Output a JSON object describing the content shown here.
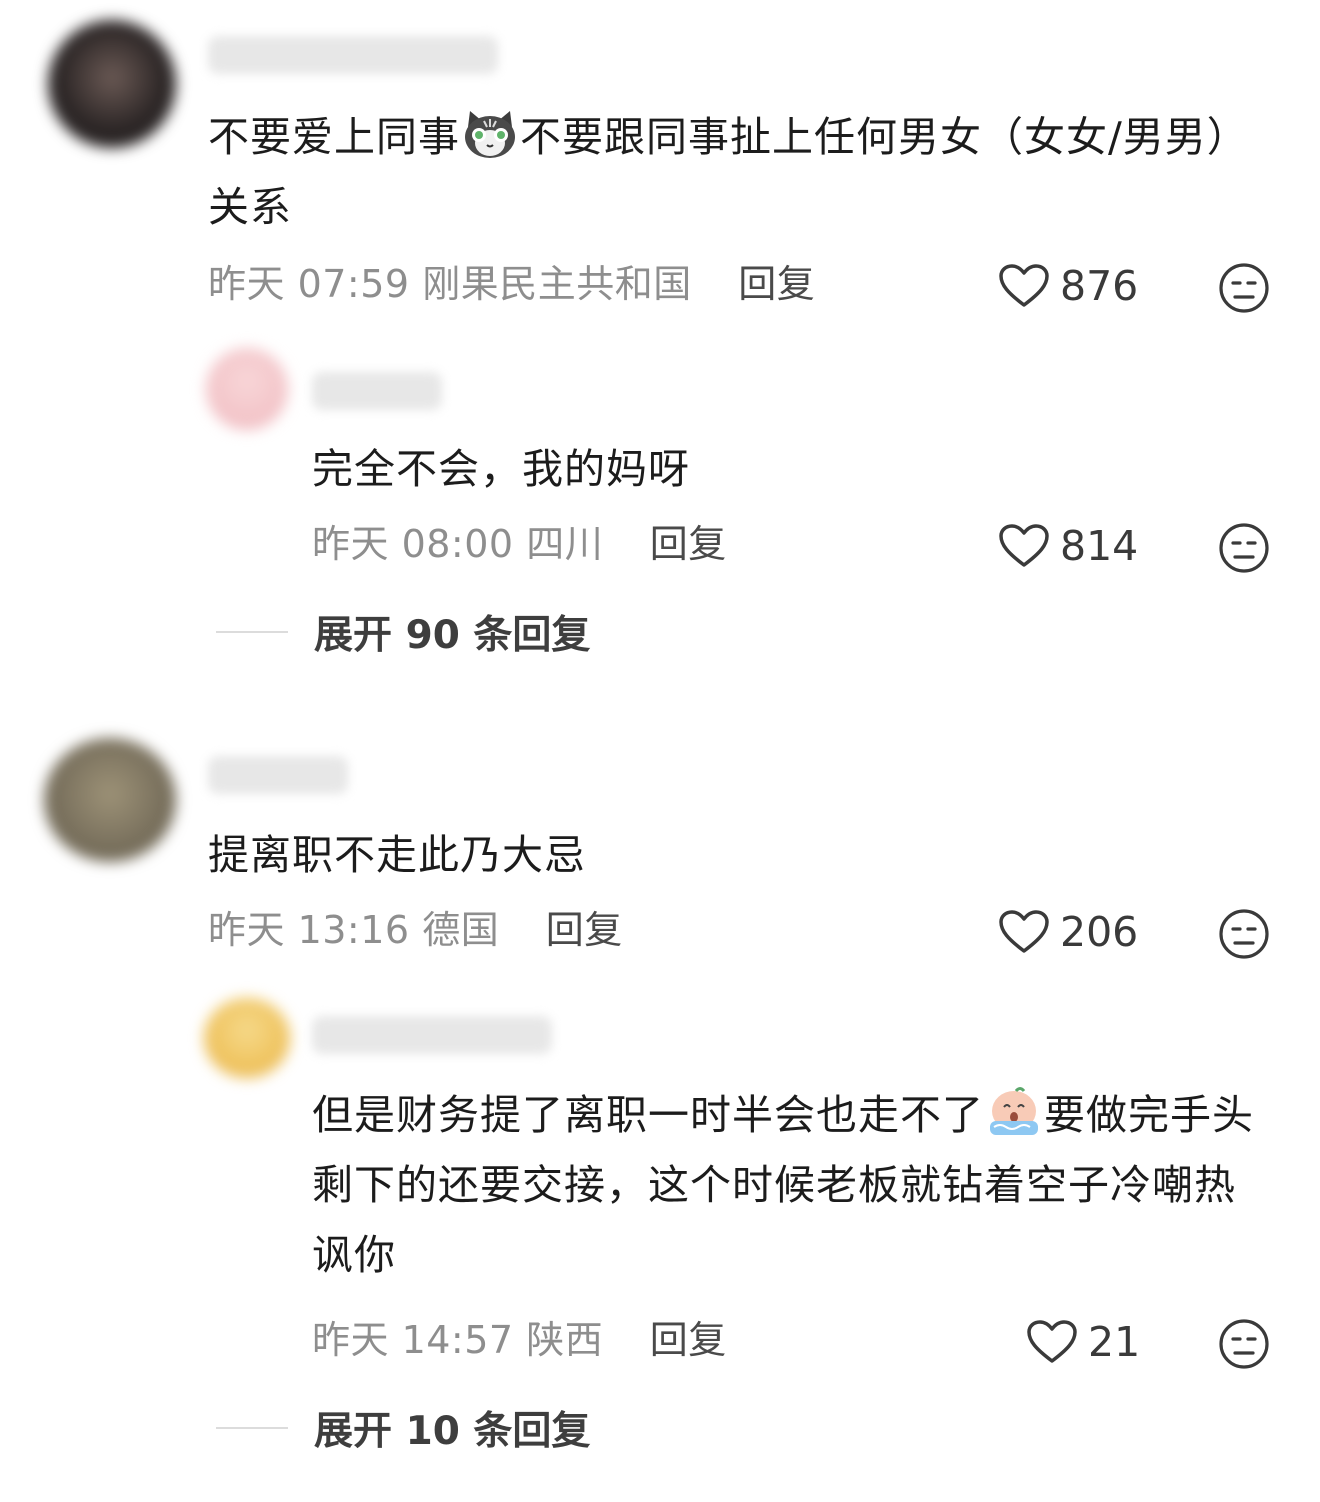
{
  "comments": [
    {
      "text_part1": "不要爱上同事",
      "emoji1": "cat-emoji",
      "text_part2": "不要跟同事扯上任何男女（女女/男男）关系",
      "time": "昨天 07:59",
      "location": "刚果民主共和国",
      "reply_label": "回复",
      "likes": "876",
      "replies": [
        {
          "text": "完全不会，我的妈呀",
          "time": "昨天 08:00",
          "location": "四川",
          "reply_label": "回复",
          "likes": "814"
        }
      ],
      "expand_label": "展开 90 条回复"
    },
    {
      "text": "提离职不走此乃大忌",
      "time": "昨天 13:16",
      "location": "德国",
      "reply_label": "回复",
      "likes": "206",
      "replies": [
        {
          "text_part1": "但是财务提了离职一时半会也走不了",
          "emoji1": "crying-emoji",
          "text_part2": "要做完手头剩下的还要交接，这个时候老板就钻着空子冷嘲热讽你",
          "time": "昨天 14:57",
          "location": "陕西",
          "reply_label": "回复",
          "likes": "21"
        }
      ],
      "expand_label": "展开 10 条回复"
    }
  ],
  "icons": {
    "like": "heart-outline-icon",
    "dislike": "meh-face-icon"
  },
  "colors": {
    "text": "#1c1c1c",
    "meta": "#8e8e8e",
    "reply": "#4a4a4a"
  }
}
